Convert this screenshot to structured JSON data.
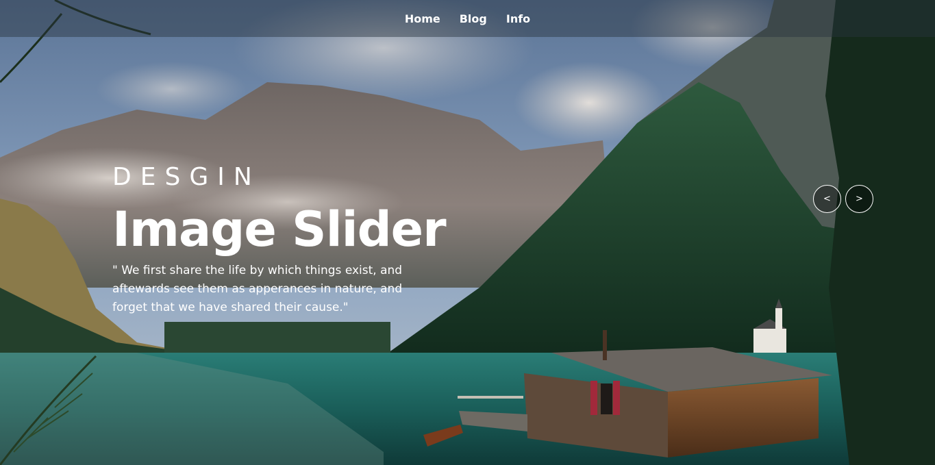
{
  "nav": {
    "items": [
      {
        "label": "Home"
      },
      {
        "label": "Blog"
      },
      {
        "label": "Info"
      }
    ]
  },
  "hero": {
    "eyebrow": "DESGIN",
    "title": "Image Slider",
    "quote": "\" We first share the life by which things exist, and aftewards see them as apperances in nature, and forget that we have shared their cause.\""
  },
  "slider": {
    "prev_label": "<",
    "next_label": ">"
  },
  "colors": {
    "nav_bg": "#28323e",
    "text": "#ffffff",
    "lake": "#1f6e68",
    "forest": "#1f4a32",
    "sky": "#7a95b8"
  }
}
